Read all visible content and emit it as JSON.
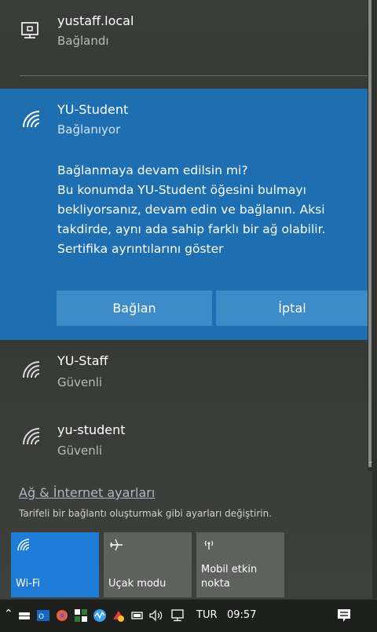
{
  "networks": {
    "wired": {
      "name": "yustaff.local",
      "status": "Bağlandı",
      "icon": "ethernet-icon"
    },
    "selected": {
      "name": "YU-Student",
      "status": "Bağlanıyor",
      "icon": "wifi-icon",
      "prompt_lines": [
        "Bağlanmaya devam edilsin mi?",
        "Bu konumda YU-Student öğesini bulmayı",
        "bekliyorsanız, devam edin ve bağlanın. Aksi",
        "takdirde, aynı ada sahip farklı bir ağ olabilir.",
        "Sertifika ayrıntılarını göster"
      ],
      "connect_label": "Bağlan",
      "cancel_label": "İptal"
    },
    "list": [
      {
        "name": "YU-Staff",
        "status": "Güvenli",
        "icon": "wifi-icon"
      },
      {
        "name": "yu-student",
        "status": "Güvenli",
        "icon": "wifi-icon"
      }
    ]
  },
  "settings": {
    "link": "Ağ & İnternet ayarları",
    "description": "Tarifeli bir bağlantı oluşturmak gibi ayarları değiştirin."
  },
  "quick_actions": [
    {
      "label": "Wi-Fi",
      "icon": "wifi-icon",
      "active": true
    },
    {
      "label": "Uçak modu",
      "icon": "airplane-icon",
      "active": false
    },
    {
      "label": "Mobil etkin nokta",
      "label_line1": "Mobil etkin",
      "label_line2": "nokta",
      "icon": "hotspot-icon",
      "active": false
    }
  ],
  "taskbar": {
    "language": "TUR",
    "time": "09:57",
    "tray_icons": [
      "chevron-up-icon",
      "drive-icon",
      "outlook-icon",
      "browser-icon",
      "security-icon",
      "network-activity-icon",
      "alert-icon",
      "battery-icon",
      "speaker-icon",
      "ethernet-icon"
    ],
    "notification_icon": "action-center-icon"
  },
  "colors": {
    "accent": "#1d6fb2",
    "tile_active": "#1f7cd6",
    "tile_inactive": "#5f615f",
    "button": "#3d8bc7"
  }
}
